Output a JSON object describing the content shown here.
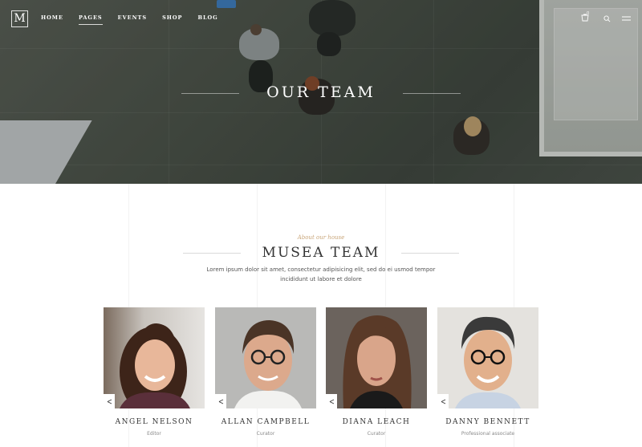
{
  "header": {
    "logo_letter": "M",
    "nav": [
      "HOME",
      "PAGES",
      "EVENTS",
      "SHOP",
      "BLOG"
    ],
    "active_nav": "PAGES",
    "cart_count": "0",
    "icons": [
      "cart-icon",
      "search-icon",
      "menu-icon"
    ]
  },
  "hero": {
    "title": "OUR TEAM"
  },
  "section": {
    "subtitle": "About our house",
    "title": "MUSEA TEAM",
    "description": "Lorem ipsum dolor sit amet, consectetur adipisicing elit, sed do ei usmod tempor incididunt ut labore et dolore"
  },
  "team": [
    {
      "name": "ANGEL NELSON",
      "role": "Editor"
    },
    {
      "name": "ALLAN CAMPBELL",
      "role": "Curator"
    },
    {
      "name": "DIANA LEACH",
      "role": "Curator"
    },
    {
      "name": "DANNY BENNETT",
      "role": "Professional associate"
    }
  ],
  "colors": {
    "accent": "#c9a67a",
    "hero_floor": "#4a5148",
    "text_dark": "#333333",
    "text_muted": "#888888"
  }
}
